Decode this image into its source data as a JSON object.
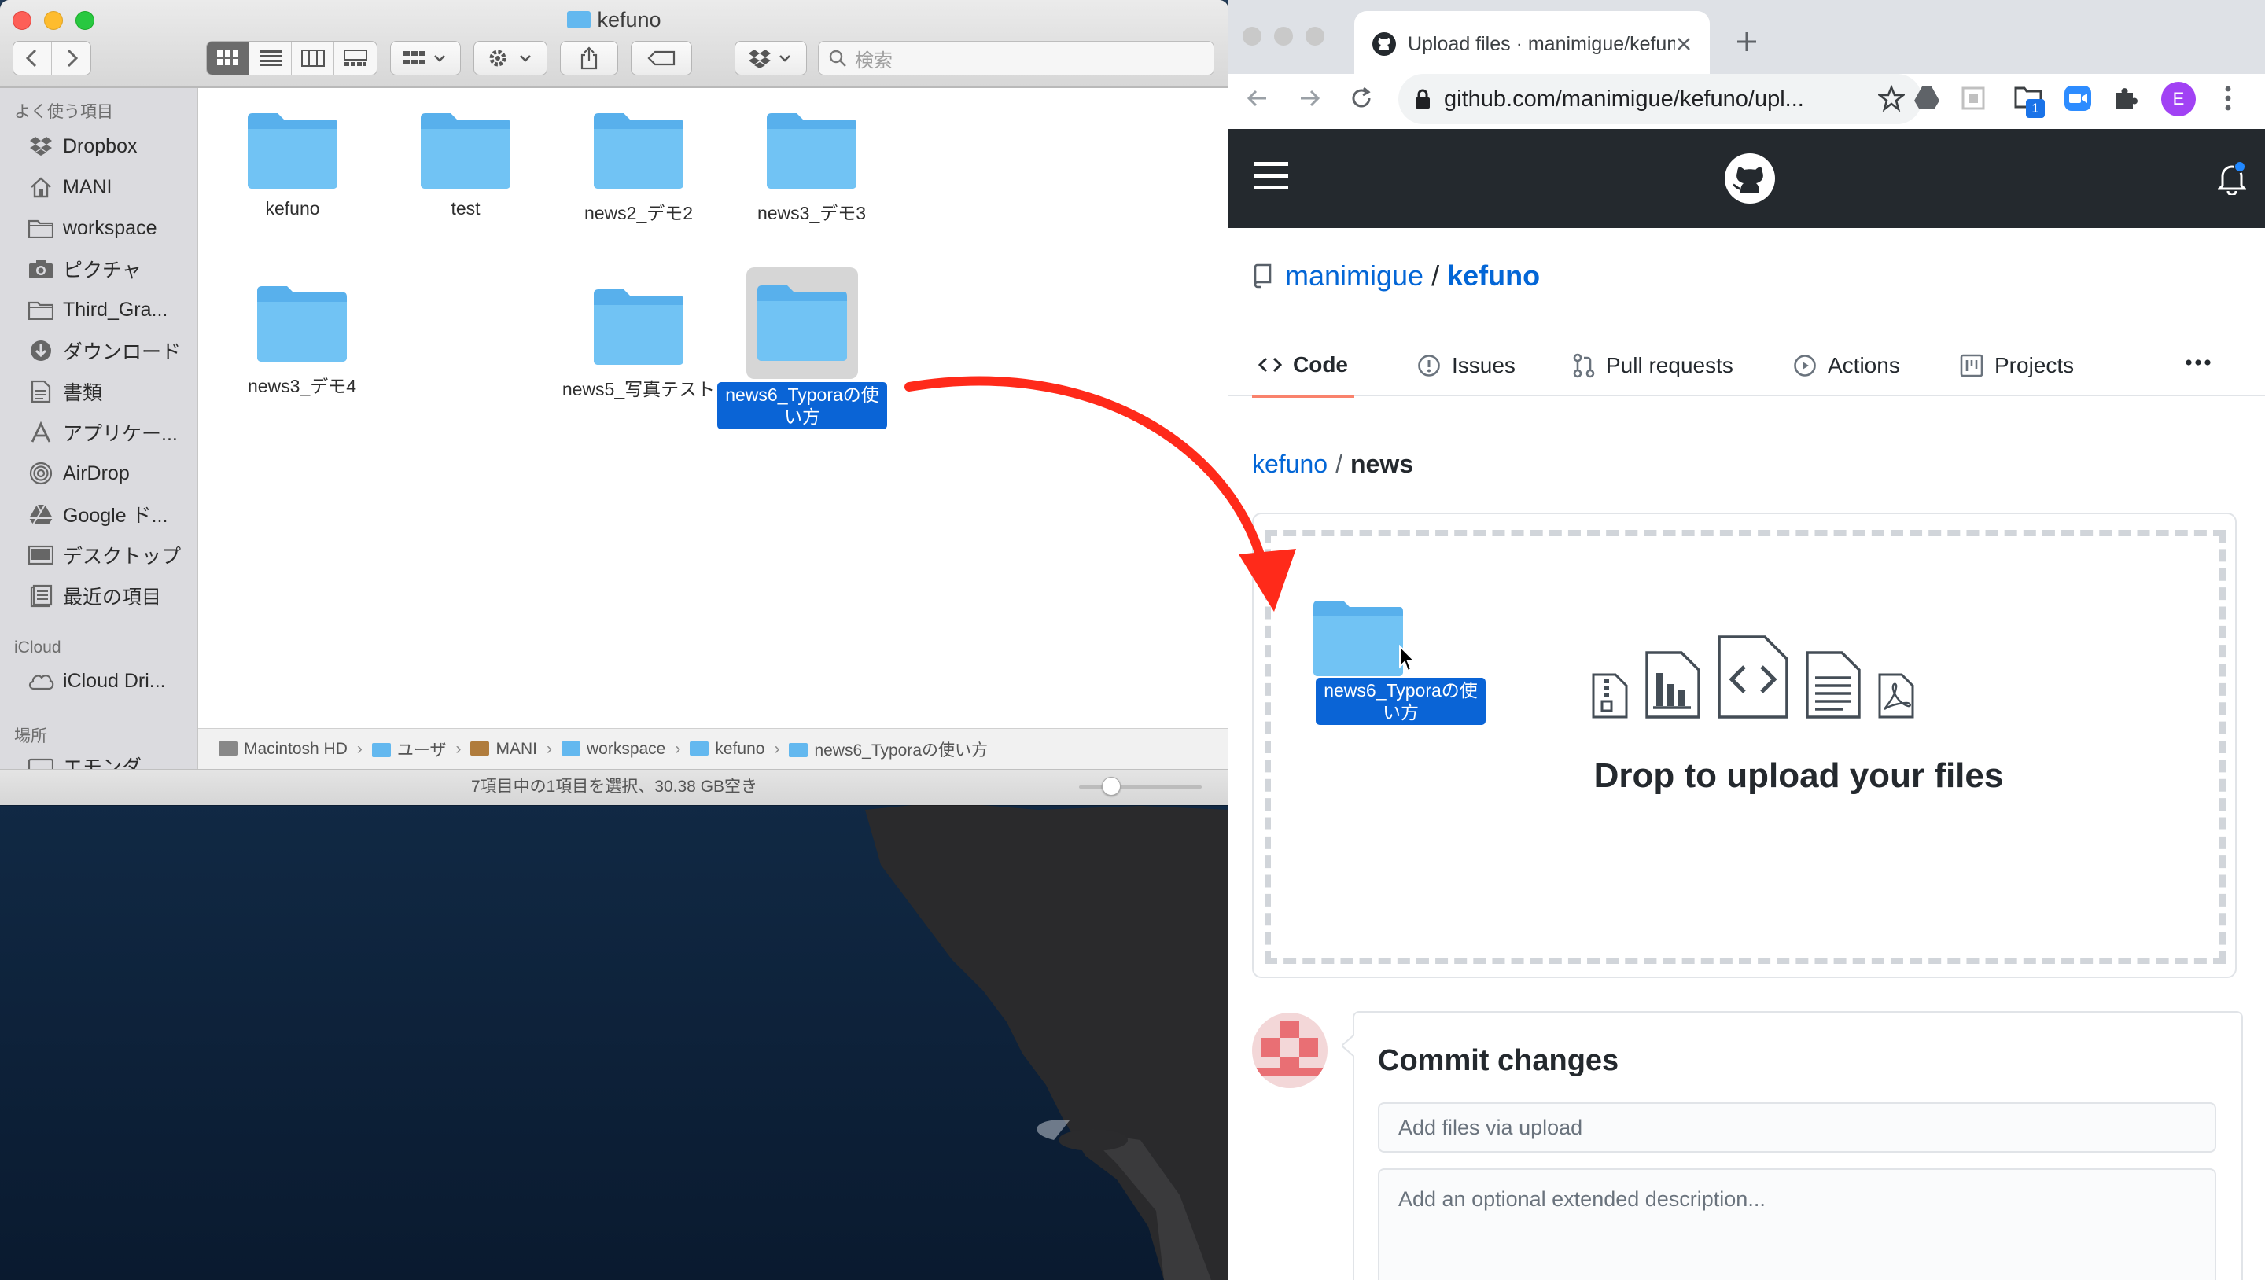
{
  "finder": {
    "title": "kefuno",
    "search_placeholder": "検索",
    "sidebar": {
      "sections": [
        "よく使う項目",
        "iCloud",
        "場所"
      ],
      "items": [
        {
          "label": "Dropbox",
          "icon": "dropbox-icon"
        },
        {
          "label": "MANI",
          "icon": "home-icon"
        },
        {
          "label": "workspace",
          "icon": "folder-icon"
        },
        {
          "label": "ピクチャ",
          "icon": "camera-icon"
        },
        {
          "label": "Third_Gra...",
          "icon": "folder-icon"
        },
        {
          "label": "ダウンロード",
          "icon": "download-icon"
        },
        {
          "label": "書類",
          "icon": "document-icon"
        },
        {
          "label": "アプリケー...",
          "icon": "applications-icon"
        },
        {
          "label": "AirDrop",
          "icon": "airdrop-icon"
        },
        {
          "label": "Google ド...",
          "icon": "google-drive-icon"
        },
        {
          "label": "デスクトップ",
          "icon": "desktop-icon"
        },
        {
          "label": "最近の項目",
          "icon": "recents-icon"
        }
      ],
      "icloud_items": [
        {
          "label": "iCloud Dri...",
          "icon": "icloud-icon"
        }
      ],
      "place_items": [
        {
          "label": "エモンダ",
          "icon": "disk-icon"
        }
      ]
    },
    "files": [
      "kefuno",
      "test",
      "news2_デモ2",
      "news3_デモ3",
      "news3_デモ4",
      "news5_写真テスト",
      "news6_Typoraの使い方"
    ],
    "selected_file": "news6_Typoraの使い方",
    "path": [
      "Macintosh HD",
      "ユーザ",
      "MANI",
      "workspace",
      "kefuno",
      "news6_Typoraの使い方"
    ],
    "status": "7項目中の1項目を選択、30.38 GB空き",
    "icon_size_slider": 0.22
  },
  "chrome": {
    "tab_title": "Upload files · manimigue/kefuno",
    "url": "github.com/manimigue/kefuno/upl...",
    "profile_initial": "E",
    "extension_badge": "1"
  },
  "github": {
    "owner": "manimigue",
    "repo": "kefuno",
    "tabs": [
      {
        "label": "Code",
        "icon": "code-icon"
      },
      {
        "label": "Issues",
        "icon": "issue-icon"
      },
      {
        "label": "Pull requests",
        "icon": "pull-request-icon"
      },
      {
        "label": "Actions",
        "icon": "play-icon"
      },
      {
        "label": "Projects",
        "icon": "project-icon"
      }
    ],
    "active_tab": "Code",
    "crumb_repo": "kefuno",
    "crumb_dir": "news",
    "drop_text": "Drop to upload your files",
    "dragged_item": "news6_Typoraの使い方",
    "commit_title": "Commit changes",
    "commit_summary_placeholder": "Add files via upload",
    "commit_desc_placeholder": "Add an optional extended description..."
  },
  "colors": {
    "accent": "#0a64d6",
    "link": "#0366d6",
    "github_header": "#24292e",
    "active_tab_underline": "#f9826c",
    "arrow": "#ff2a1a"
  }
}
